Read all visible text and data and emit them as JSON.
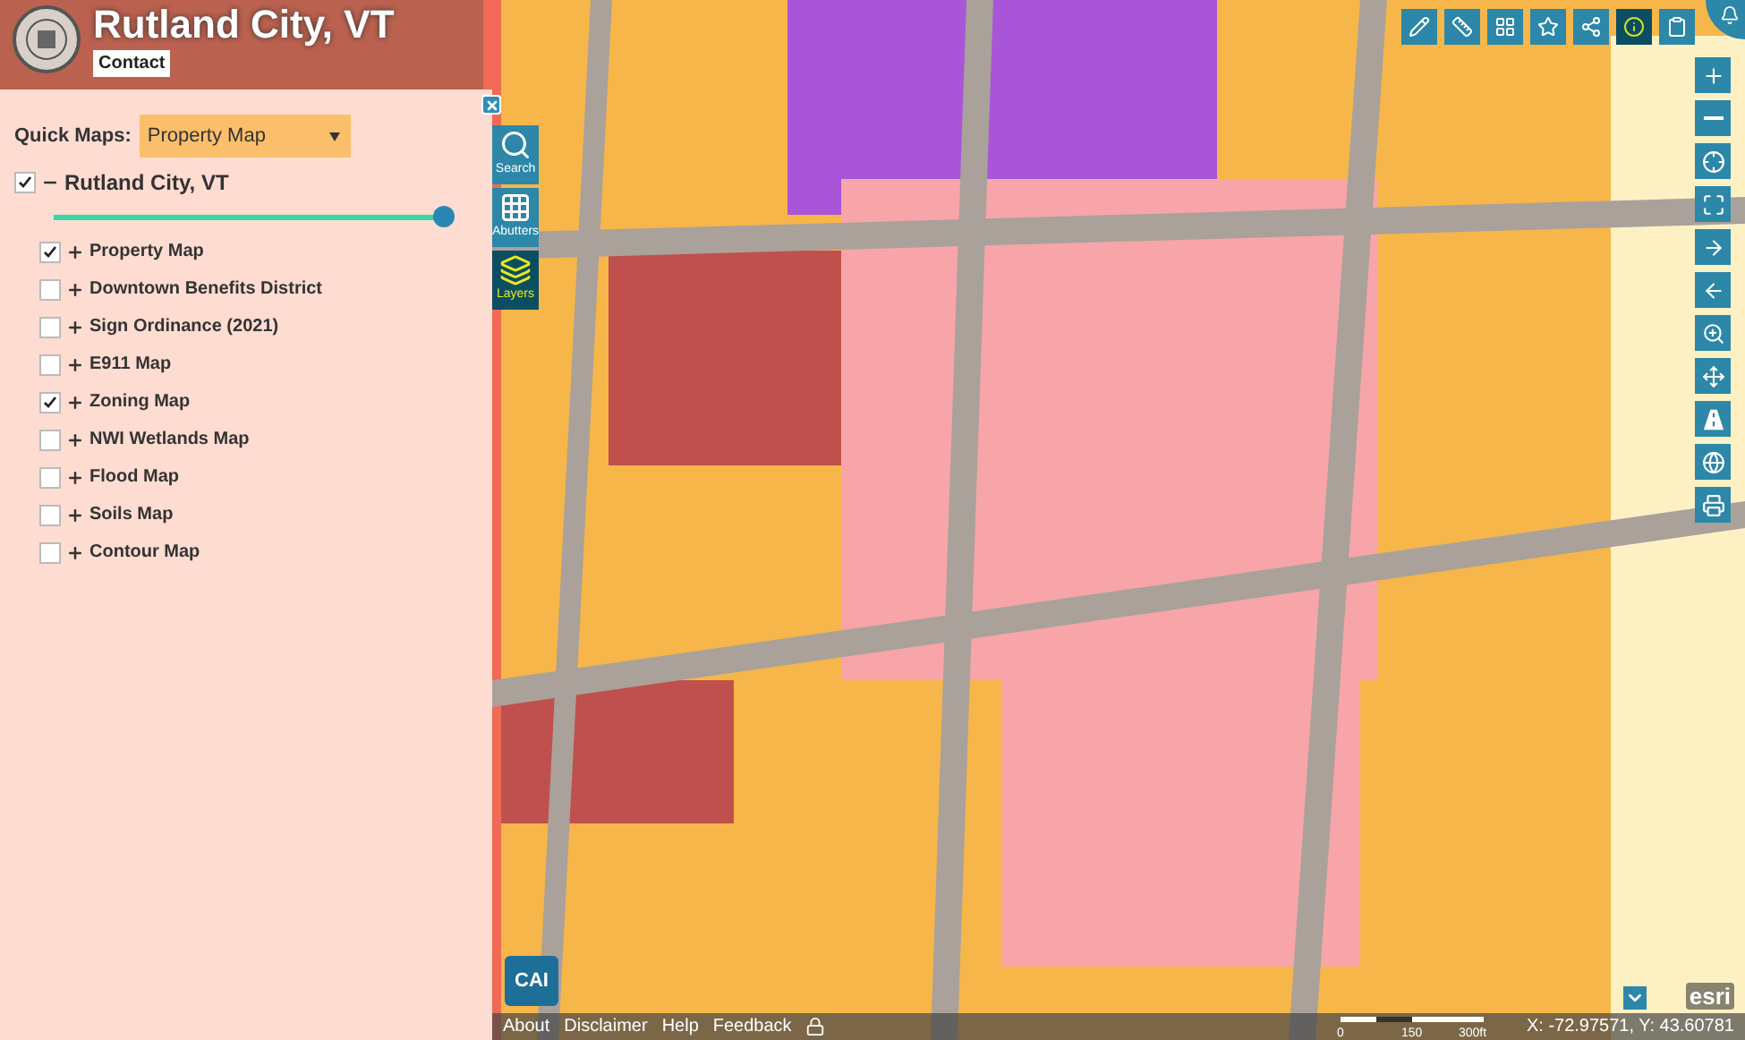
{
  "header": {
    "title": "Rutland City, VT",
    "contact": "Contact"
  },
  "panel": {
    "quick_maps_label": "Quick Maps:",
    "quick_maps_value": "Property Map",
    "group": {
      "label": "Rutland City, VT",
      "checked": true,
      "expanded": true,
      "level": 1,
      "children": [
        {
          "label": "Property Map",
          "checked": true,
          "expanded": false
        },
        {
          "label": "Downtown Benefits District",
          "checked": false,
          "expanded": false
        },
        {
          "label": " Sign Ordinance (2021)",
          "checked": false,
          "expanded": false
        },
        {
          "label": "E911 Map",
          "checked": false,
          "expanded": false
        },
        {
          "label": "Zoning Map",
          "checked": true,
          "expanded": false
        },
        {
          "label": "NWI Wetlands Map",
          "checked": false,
          "expanded": false
        },
        {
          "label": "Flood Map",
          "checked": false,
          "expanded": false
        },
        {
          "label": "Soils Map",
          "checked": false,
          "expanded": false
        },
        {
          "label": "Contour Map",
          "checked": false,
          "expanded": false
        }
      ]
    }
  },
  "side_tools": [
    {
      "kind": "search",
      "label": "Search",
      "selected": false
    },
    {
      "kind": "abutters",
      "label": "Abutters",
      "selected": false
    },
    {
      "kind": "layers",
      "label": "Layers",
      "selected": true
    }
  ],
  "top_tools": [
    {
      "kind": "pencil",
      "selected": false
    },
    {
      "kind": "ruler",
      "selected": false
    },
    {
      "kind": "grid",
      "selected": false
    },
    {
      "kind": "star",
      "selected": false
    },
    {
      "kind": "share",
      "selected": false
    },
    {
      "kind": "info",
      "selected": true
    },
    {
      "kind": "clipboard",
      "selected": false
    }
  ],
  "right_tools": [
    {
      "kind": "zoom-in"
    },
    {
      "kind": "zoom-out"
    },
    {
      "kind": "locate"
    },
    {
      "kind": "extent"
    },
    {
      "kind": "next"
    },
    {
      "kind": "previous"
    },
    {
      "kind": "zoom-box"
    },
    {
      "kind": "pan"
    },
    {
      "kind": "road"
    },
    {
      "kind": "globe"
    },
    {
      "kind": "print"
    }
  ],
  "logos": {
    "cai": "CAI",
    "esri": "esri"
  },
  "footer": {
    "links": [
      "About",
      "Disclaimer",
      "Help",
      "Feedback"
    ],
    "scale": [
      "0",
      "150",
      "300ft"
    ],
    "coords": "X: -72.97571, Y: 43.60781"
  }
}
